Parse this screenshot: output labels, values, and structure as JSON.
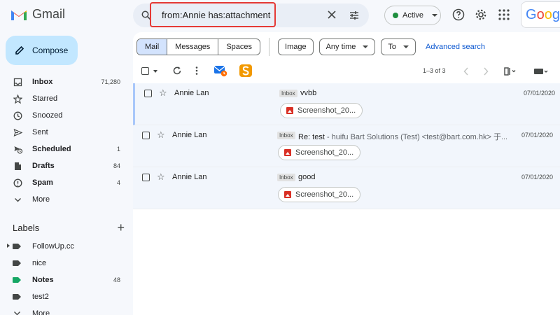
{
  "app": {
    "logo_text": "Gmail"
  },
  "compose": {
    "label": "Compose"
  },
  "nav": [
    {
      "label": "Inbox",
      "count": "71,280",
      "icon": "inbox-icon",
      "bold": true
    },
    {
      "label": "Starred",
      "count": "",
      "icon": "star-icon",
      "bold": false
    },
    {
      "label": "Snoozed",
      "count": "",
      "icon": "clock-icon",
      "bold": false
    },
    {
      "label": "Sent",
      "count": "",
      "icon": "send-icon",
      "bold": false
    },
    {
      "label": "Scheduled",
      "count": "1",
      "icon": "scheduled-icon",
      "bold": true
    },
    {
      "label": "Drafts",
      "count": "84",
      "icon": "draft-icon",
      "bold": true
    },
    {
      "label": "Spam",
      "count": "4",
      "icon": "spam-icon",
      "bold": true
    },
    {
      "label": "More",
      "count": "",
      "icon": "chevron-down-icon",
      "bold": false
    }
  ],
  "labels": {
    "heading": "Labels",
    "items": [
      {
        "label": "FollowUp.cc",
        "count": "",
        "bold": false,
        "color": "#444746"
      },
      {
        "label": "nice",
        "count": "",
        "bold": false,
        "color": "#444746"
      },
      {
        "label": "Notes",
        "count": "48",
        "bold": true,
        "color": "#16a765"
      },
      {
        "label": "test2",
        "count": "",
        "bold": false,
        "color": "#444746"
      },
      {
        "label": "More",
        "count": "",
        "bold": false,
        "color": "#444746"
      }
    ]
  },
  "search": {
    "query": "from:Annie has:attachment"
  },
  "status": {
    "label": "Active",
    "color": "#1e8e3e"
  },
  "brand": {
    "text": "Googl"
  },
  "filters": {
    "segments": [
      "Mail",
      "Messages",
      "Spaces"
    ],
    "selected": "Mail",
    "chips": [
      "Image",
      "Any time",
      "To"
    ],
    "advanced": "Advanced search"
  },
  "pager": {
    "text": "1–3 of 3"
  },
  "emails": [
    {
      "sender": "Annie Lan",
      "badge": "Inbox",
      "subject": "vvbb",
      "snippet": "",
      "date": "07/01/2020",
      "attachment": "Screenshot_20..."
    },
    {
      "sender": "Annie Lan",
      "badge": "Inbox",
      "subject": "Re: test",
      "snippet": " - huifu Bart Solutions (Test) <test@bart.com.hk> 于...",
      "date": "07/01/2020",
      "attachment": "Screenshot_20..."
    },
    {
      "sender": "Annie Lan",
      "badge": "Inbox",
      "subject": "good",
      "snippet": "",
      "date": "07/01/2020",
      "attachment": "Screenshot_20..."
    }
  ]
}
